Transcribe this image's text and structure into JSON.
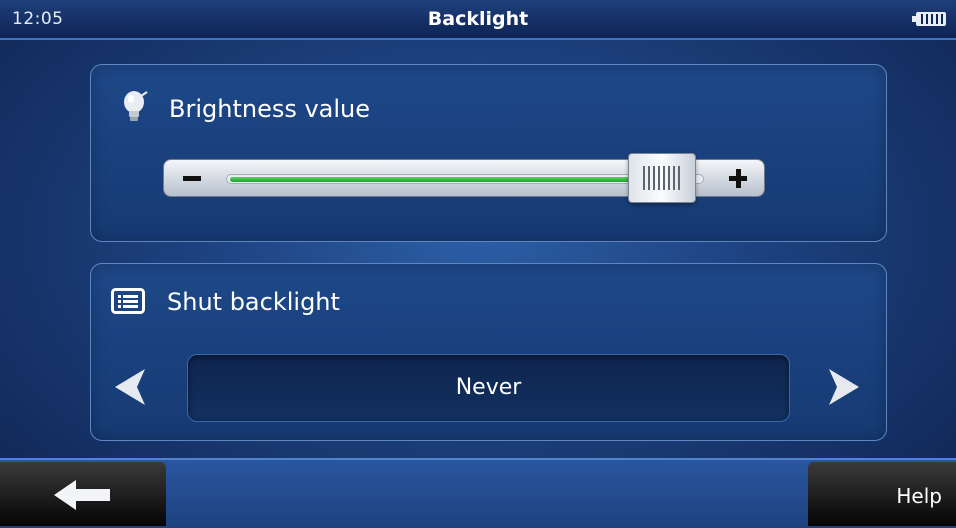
{
  "status_bar": {
    "time": "12:05",
    "title": "Backlight",
    "battery_icon": "battery-full-icon"
  },
  "brightness": {
    "label": "Brightness value",
    "icon": "lightbulb-icon",
    "level": 0.86,
    "decrease_icon": "minus-icon",
    "increase_icon": "plus-icon"
  },
  "shut_backlight": {
    "label": "Shut backlight",
    "icon": "list-icon",
    "value": "Never",
    "prev_icon": "arrow-left-icon",
    "next_icon": "arrow-right-icon"
  },
  "footer": {
    "back_icon": "back-arrow-icon",
    "help_label": "Help"
  },
  "colors": {
    "accent_green": "#23a034",
    "background_blue": "#1c3f7c"
  }
}
